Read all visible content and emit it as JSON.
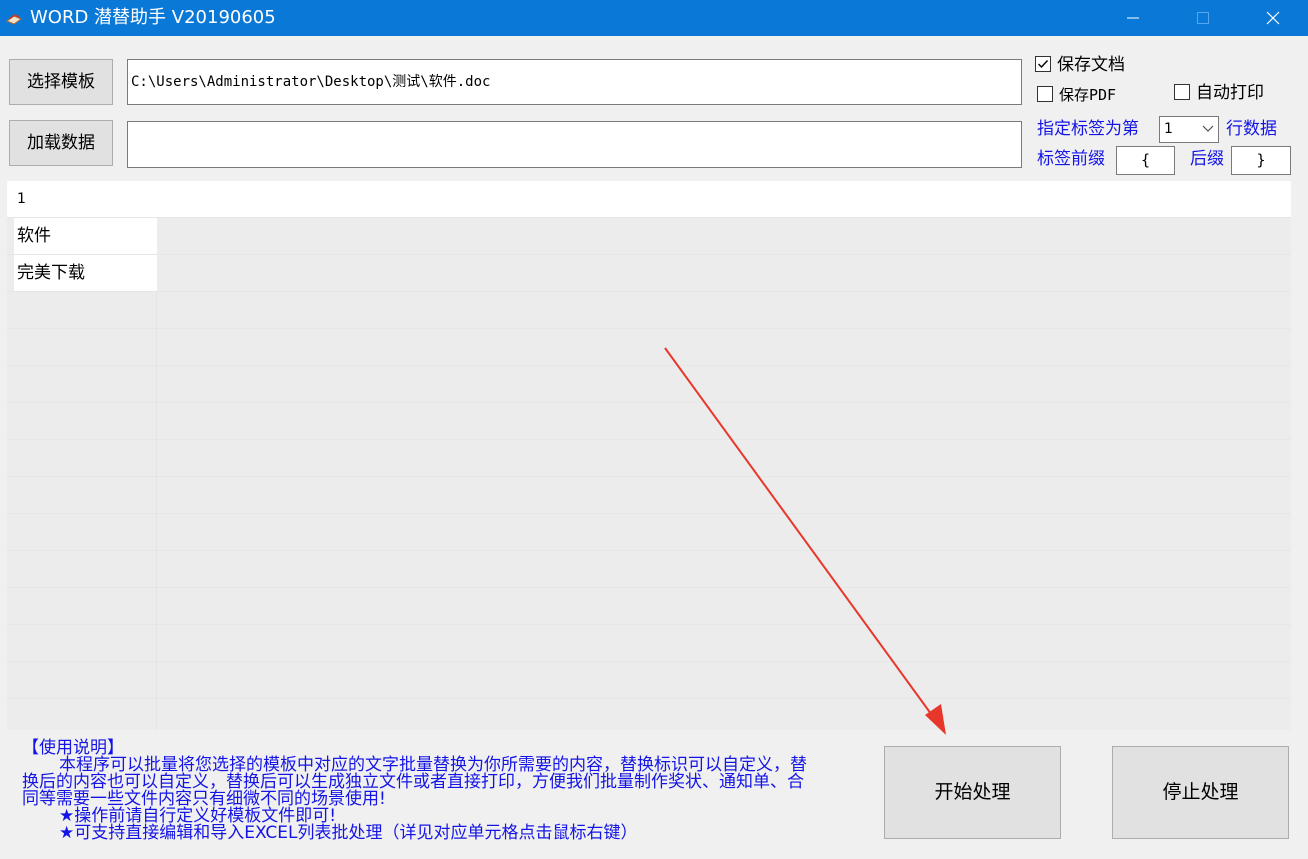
{
  "window": {
    "title": "WORD 潜替助手 V20190605",
    "title_bar_color": "#0a78d7"
  },
  "controls": {
    "select_template_label": "选择模板",
    "load_data_label": "加载数据",
    "template_path": "C:\\Users\\Administrator\\Desktop\\测试\\软件.doc",
    "data_path": "",
    "save_doc": {
      "label": "保存文档",
      "checked": true
    },
    "save_pdf": {
      "label": "保存PDF",
      "checked": false
    },
    "auto_print": {
      "label": "自动打印",
      "checked": false
    },
    "tag_row_label": "指定标签为第",
    "tag_row_value": "1",
    "row_data_label": "行数据",
    "prefix_label": "标签前缀",
    "prefix_value": "{",
    "suffix_label": "后缀",
    "suffix_value": "}",
    "accent_color": "#1414e6"
  },
  "grid": {
    "rows": [
      {
        "col1": "1"
      },
      {
        "col1": "软件"
      },
      {
        "col1": "完美下载"
      }
    ]
  },
  "instructions": {
    "title": "【使用说明】",
    "line1": "本程序可以批量将您选择的模板中对应的文字批量替换为你所需要的内容，替换标识可以自定义，替",
    "line2": "换后的内容也可以自定义，替换后可以生成独立文件或者直接打印，方便我们批量制作奖状、通知单、合",
    "line3": "同等需要一些文件内容只有细微不同的场景使用!",
    "tip1": "★操作前请自行定义好模板文件即可!",
    "tip2": "★可支持直接编辑和导入EXCEL列表批处理（详见对应单元格点击鼠标右键）"
  },
  "actions": {
    "start_label": "开始处理",
    "stop_label": "停止处理"
  }
}
